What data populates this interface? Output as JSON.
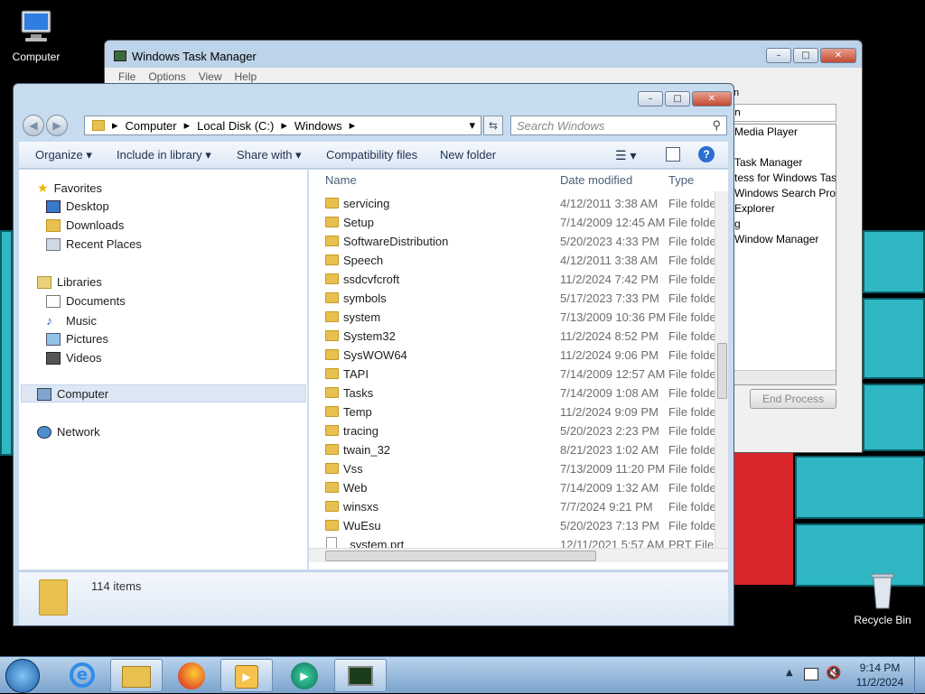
{
  "desktop": {
    "icons": [
      {
        "label": "Computer"
      },
      {
        "label": "Recycle Bin"
      }
    ]
  },
  "task_manager": {
    "title": "Windows Task Manager",
    "menu": [
      "File",
      "Options",
      "View",
      "Help"
    ],
    "visible_tab_fragment": "n",
    "processes": [
      "Media Player",
      "",
      "Task Manager",
      "tess for Windows Tasks",
      "Windows Search Prot...",
      "Explorer",
      "g",
      "Window Manager"
    ],
    "end_process_label": "End Process"
  },
  "explorer": {
    "breadcrumb": [
      "Computer",
      "Local Disk (C:)",
      "Windows"
    ],
    "search_placeholder": "Search Windows",
    "toolbar": {
      "organize": "Organize",
      "include_in_library": "Include in library",
      "share_with": "Share with",
      "compatibility_files": "Compatibility files",
      "new_folder": "New folder"
    },
    "nav": {
      "favorites": "Favorites",
      "desktop": "Desktop",
      "downloads": "Downloads",
      "recent_places": "Recent Places",
      "libraries": "Libraries",
      "documents": "Documents",
      "music": "Music",
      "pictures": "Pictures",
      "videos": "Videos",
      "computer": "Computer",
      "network": "Network"
    },
    "columns": {
      "name": "Name",
      "date": "Date modified",
      "type": "Type"
    },
    "files": [
      {
        "name": "servicing",
        "date": "4/12/2011 3:38 AM",
        "type": "File folder",
        "kind": "folder"
      },
      {
        "name": "Setup",
        "date": "7/14/2009 12:45 AM",
        "type": "File folder",
        "kind": "folder"
      },
      {
        "name": "SoftwareDistribution",
        "date": "5/20/2023 4:33 PM",
        "type": "File folder",
        "kind": "folder"
      },
      {
        "name": "Speech",
        "date": "4/12/2011 3:38 AM",
        "type": "File folder",
        "kind": "folder"
      },
      {
        "name": "ssdcvfcroft",
        "date": "11/2/2024 7:42 PM",
        "type": "File folder",
        "kind": "folder"
      },
      {
        "name": "symbols",
        "date": "5/17/2023 7:33 PM",
        "type": "File folder",
        "kind": "folder"
      },
      {
        "name": "system",
        "date": "7/13/2009 10:36 PM",
        "type": "File folder",
        "kind": "folder"
      },
      {
        "name": "System32",
        "date": "11/2/2024 8:52 PM",
        "type": "File folder",
        "kind": "folder"
      },
      {
        "name": "SysWOW64",
        "date": "11/2/2024 9:06 PM",
        "type": "File folder",
        "kind": "folder"
      },
      {
        "name": "TAPI",
        "date": "7/14/2009 12:57 AM",
        "type": "File folder",
        "kind": "folder"
      },
      {
        "name": "Tasks",
        "date": "7/14/2009 1:08 AM",
        "type": "File folder",
        "kind": "folder"
      },
      {
        "name": "Temp",
        "date": "11/2/2024 9:09 PM",
        "type": "File folder",
        "kind": "folder"
      },
      {
        "name": "tracing",
        "date": "5/20/2023 2:23 PM",
        "type": "File folder",
        "kind": "folder"
      },
      {
        "name": "twain_32",
        "date": "8/21/2023 1:02 AM",
        "type": "File folder",
        "kind": "folder"
      },
      {
        "name": "Vss",
        "date": "7/13/2009 11:20 PM",
        "type": "File folder",
        "kind": "folder"
      },
      {
        "name": "Web",
        "date": "7/14/2009 1:32 AM",
        "type": "File folder",
        "kind": "folder"
      },
      {
        "name": "winsxs",
        "date": "7/7/2024 9:21 PM",
        "type": "File folder",
        "kind": "folder"
      },
      {
        "name": "WuEsu",
        "date": "5/20/2023 7:13 PM",
        "type": "File folder",
        "kind": "folder"
      },
      {
        "name": "_system.prt",
        "date": "12/11/2021 5:57 AM",
        "type": "PRT File",
        "kind": "file"
      }
    ],
    "status_count": "114 items"
  },
  "taskbar": {
    "apps": [
      "internet-explorer",
      "windows-explorer",
      "firefox",
      "media-player",
      "media-center",
      "task-manager"
    ],
    "time": "9:14 PM",
    "date": "11/2/2024"
  }
}
